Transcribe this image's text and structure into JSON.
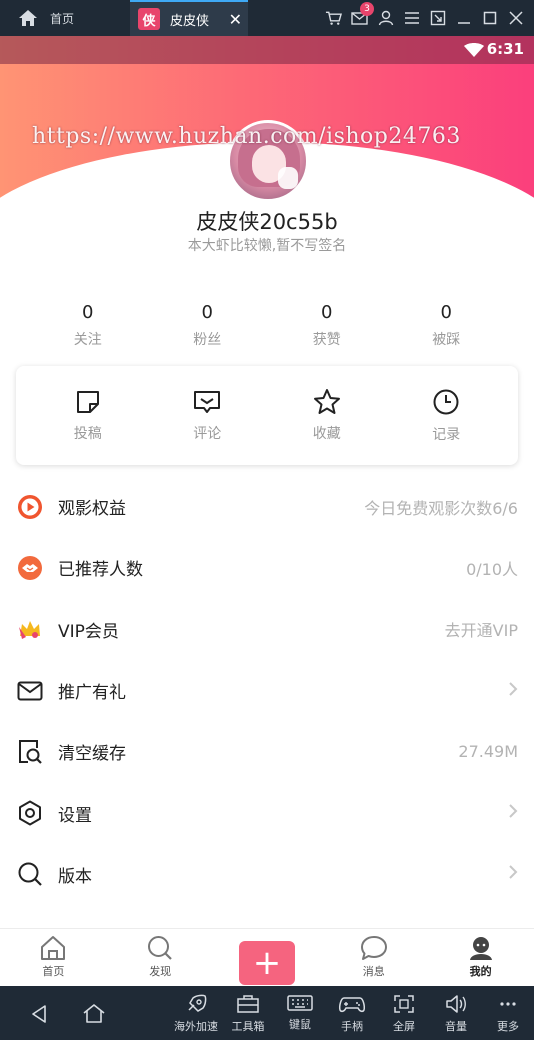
{
  "emulator": {
    "home_label": "首页",
    "tab_badge": "侠",
    "tab_title": "皮皮侠",
    "tab_close": "✕",
    "message_count": "3",
    "tools": [
      {
        "label": "海外加速",
        "icon": "rocket-icon"
      },
      {
        "label": "工具箱",
        "icon": "toolbox-icon"
      },
      {
        "label": "键鼠",
        "icon": "keyboard-icon"
      },
      {
        "label": "手柄",
        "icon": "gamepad-icon"
      },
      {
        "label": "全屏",
        "icon": "fullscreen-icon"
      },
      {
        "label": "音量",
        "icon": "volume-icon"
      },
      {
        "label": "更多",
        "icon": "more-icon"
      }
    ]
  },
  "status_bar": {
    "time": "6:31"
  },
  "watermark": "https://www.huzhan.com/ishop24763",
  "profile": {
    "username": "皮皮侠20c55b",
    "signature": "本大虾比较懒,暂不写签名"
  },
  "stats": [
    {
      "value": "0",
      "label": "关注"
    },
    {
      "value": "0",
      "label": "粉丝"
    },
    {
      "value": "0",
      "label": "获赞"
    },
    {
      "value": "0",
      "label": "被踩"
    }
  ],
  "quick_actions": [
    {
      "label": "投稿",
      "icon": "post-icon"
    },
    {
      "label": "评论",
      "icon": "comment-icon"
    },
    {
      "label": "收藏",
      "icon": "star-icon"
    },
    {
      "label": "记录",
      "icon": "clock-icon"
    }
  ],
  "menu": [
    {
      "title": "观影权益",
      "value": "今日免费观影次数6/6",
      "icon": "play-circle-icon"
    },
    {
      "title": "已推荐人数",
      "value": "0/10人",
      "icon": "handshake-icon"
    },
    {
      "title": "VIP会员",
      "value": "去开通VIP",
      "icon": "crown-icon"
    },
    {
      "title": "推广有礼",
      "value": "",
      "icon": "mail-icon"
    },
    {
      "title": "清空缓存",
      "value": "27.49M",
      "icon": "clear-cache-icon"
    },
    {
      "title": "设置",
      "value": "",
      "icon": "settings-icon"
    },
    {
      "title": "版本",
      "value": "",
      "icon": "search-icon"
    }
  ],
  "nav": [
    {
      "label": "首页",
      "icon": "home-icon"
    },
    {
      "label": "发现",
      "icon": "discover-icon"
    },
    {
      "label": "+",
      "icon": "plus-icon"
    },
    {
      "label": "消息",
      "icon": "message-icon"
    },
    {
      "label": "我的",
      "icon": "profile-icon"
    }
  ],
  "colors": {
    "accent": "#f5647f",
    "gradient_start": "#ff9474",
    "gradient_end": "#fb3f7c"
  }
}
